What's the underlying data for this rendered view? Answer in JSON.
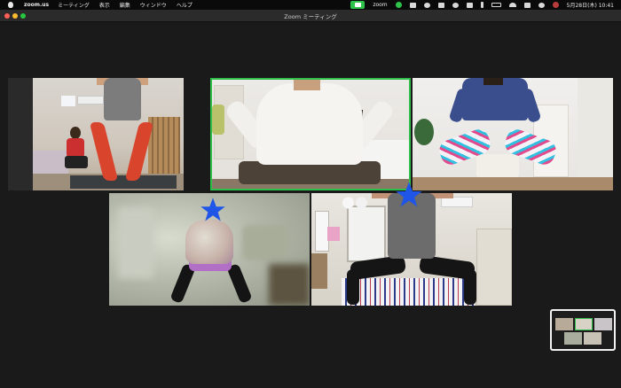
{
  "menubar": {
    "app_name": "zoom.us",
    "menus": [
      "ミーティング",
      "表示",
      "編集",
      "ウィンドウ",
      "ヘルプ"
    ],
    "zoom_label": "zoom",
    "datetime": "5月28日(木) 10:41"
  },
  "window": {
    "title": "Zoom ミーティング"
  },
  "colors": {
    "active_speaker_border": "#2fc04c",
    "star": "#1f56e8",
    "window_bg": "#1a1a1a"
  },
  "icons": {
    "star": "star-icon",
    "camera": "video-camera-icon"
  }
}
